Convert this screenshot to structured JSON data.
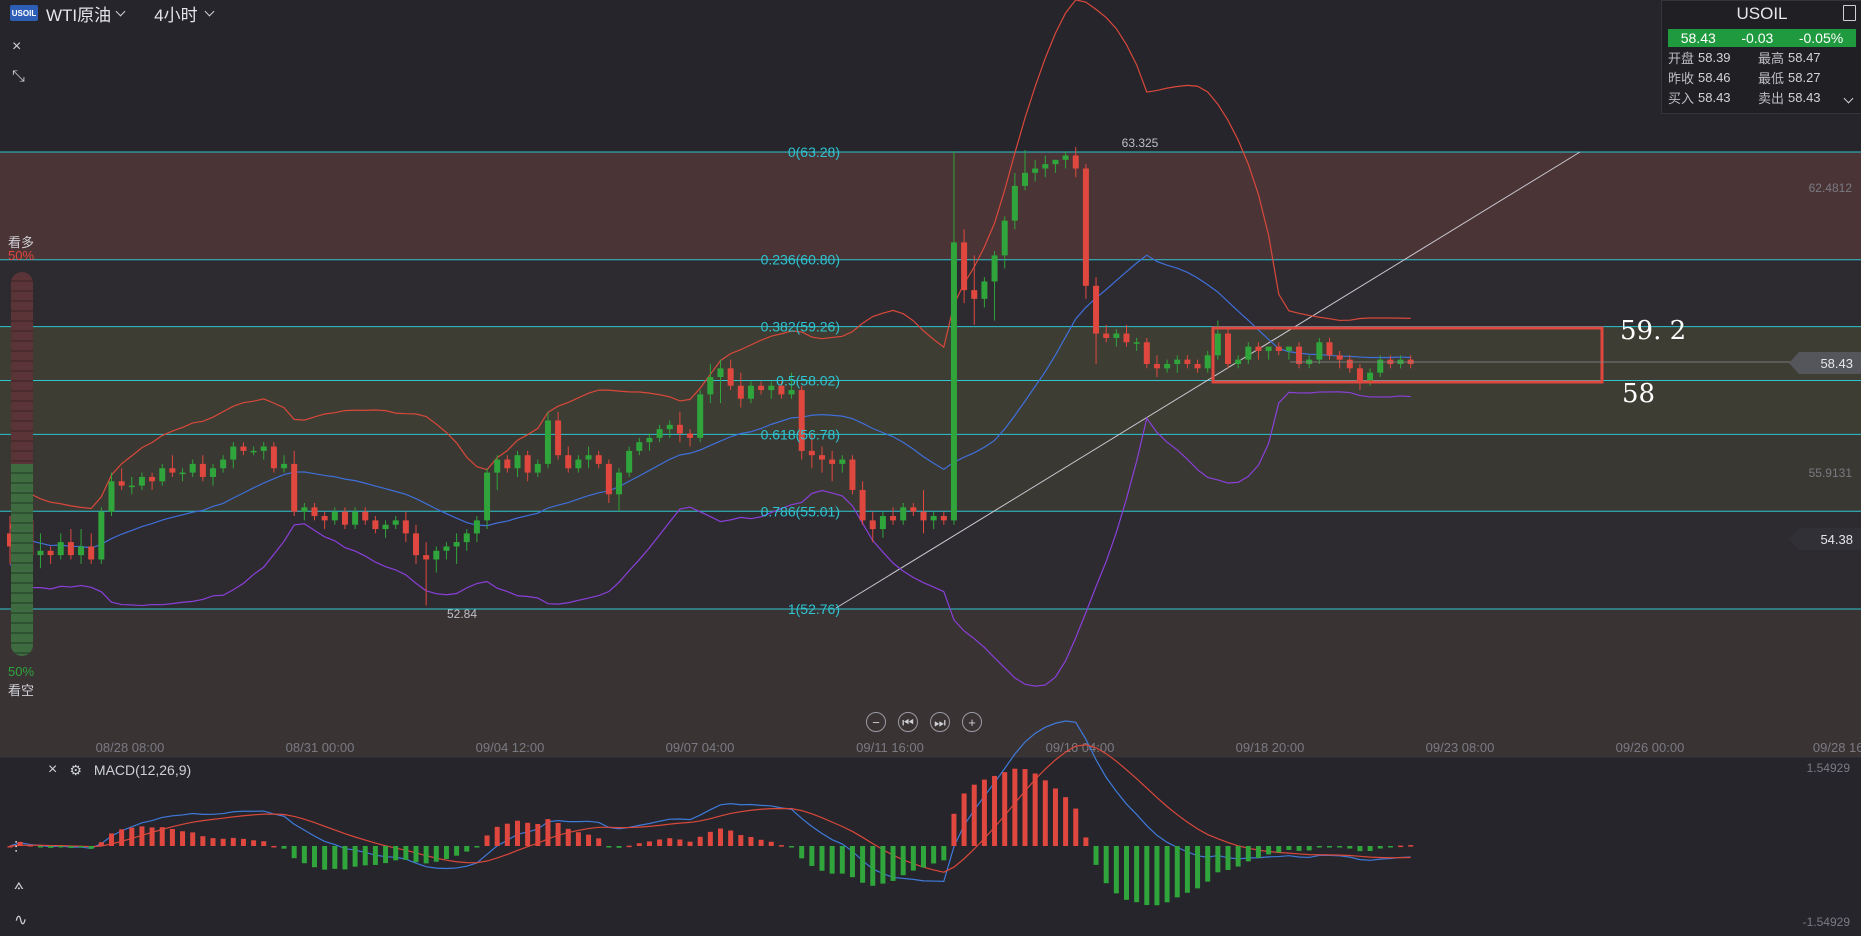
{
  "header": {
    "logo_text": "USOIL",
    "symbol": "WTI原油",
    "timeframe": "4小时"
  },
  "toolbar_left": {
    "close": "×",
    "shrink": "⤡"
  },
  "quote_panel": {
    "title": "USOIL",
    "last": "58.43",
    "change": "-0.03",
    "change_pct": "-0.05%",
    "rows": [
      [
        {
          "label": "开盘",
          "value": "58.39"
        },
        {
          "label": "最高",
          "value": "58.47"
        }
      ],
      [
        {
          "label": "昨收",
          "value": "58.46"
        },
        {
          "label": "最低",
          "value": "58.27"
        }
      ],
      [
        {
          "label": "买入",
          "value": "58.43"
        },
        {
          "label": "卖出",
          "value": "58.43"
        }
      ]
    ]
  },
  "sentiment": {
    "bull_label": "看多",
    "bull_pct": "50%",
    "bear_label": "看空",
    "bear_pct": "50%"
  },
  "price_axis": {
    "right_labels": [
      "62.4812",
      "55.9131"
    ],
    "current_price": "58.43",
    "marker_price": "54.38"
  },
  "annotations": {
    "high_label": "63.325",
    "low_label": "52.84",
    "box_top": "59. 2",
    "box_bottom": "58"
  },
  "fib_levels": [
    {
      "label": "0(63.28)",
      "price": 63.28
    },
    {
      "label": "0.236(60.80)",
      "price": 60.8
    },
    {
      "label": "0.382(59.26)",
      "price": 59.26
    },
    {
      "label": "0.5(58.02)",
      "price": 58.02
    },
    {
      "label": "0.618(56.78)",
      "price": 56.78
    },
    {
      "label": "0.786(55.01)",
      "price": 55.01
    },
    {
      "label": "1(52.76)",
      "price": 52.76
    }
  ],
  "time_axis": [
    "08/28 08:00",
    "08/31 00:00",
    "09/04 12:00",
    "09/07 04:00",
    "09/11 16:00",
    "09/16 04:00",
    "09/18 20:00",
    "09/23 08:00",
    "09/26 00:00",
    "09/28 16:"
  ],
  "macd": {
    "title": "MACD(12,26,9)",
    "axis_top": "1.54929",
    "axis_bottom": "-1.54929"
  },
  "colors": {
    "up": "#2fa53b",
    "down": "#e0483f",
    "fib": "#2ec4d0",
    "bb_upper": "#d9483b",
    "bb_mid": "#3f6fd9",
    "bb_lower": "#8a3fd9",
    "macd_line": "#3f7ad9",
    "signal_line": "#d9483b"
  },
  "nav_buttons": [
    "−",
    "⏮",
    "⏭",
    "+"
  ],
  "chart_data": {
    "type": "candlestick",
    "ylim": [
      51.5,
      65.5
    ],
    "candles": [
      [
        54.5,
        54.9,
        53.8,
        54.2
      ],
      [
        54.2,
        55.0,
        53.9,
        54.8
      ],
      [
        54.8,
        55.2,
        53.9,
        54.0
      ],
      [
        54.0,
        54.5,
        53.7,
        54.1
      ],
      [
        54.1,
        54.2,
        53.8,
        54.0
      ],
      [
        54.0,
        54.5,
        53.9,
        54.3
      ],
      [
        54.3,
        54.6,
        53.9,
        54.0
      ],
      [
        54.0,
        54.6,
        53.8,
        54.2
      ],
      [
        54.2,
        54.5,
        53.8,
        53.9
      ],
      [
        53.9,
        55.1,
        53.8,
        55.0
      ],
      [
        55.0,
        55.9,
        54.9,
        55.7
      ],
      [
        55.7,
        56.0,
        55.5,
        55.6
      ],
      [
        55.6,
        55.8,
        55.4,
        55.6
      ],
      [
        55.6,
        55.9,
        55.5,
        55.8
      ],
      [
        55.8,
        55.9,
        55.5,
        55.7
      ],
      [
        55.7,
        56.1,
        55.6,
        56.0
      ],
      [
        56.0,
        56.3,
        55.8,
        55.9
      ],
      [
        55.9,
        56.0,
        55.7,
        55.9
      ],
      [
        55.9,
        56.2,
        55.8,
        56.1
      ],
      [
        56.1,
        56.3,
        55.7,
        55.8
      ],
      [
        55.8,
        56.1,
        55.6,
        56.0
      ],
      [
        56.0,
        56.3,
        55.9,
        56.2
      ],
      [
        56.2,
        56.6,
        56.0,
        56.5
      ],
      [
        56.5,
        56.6,
        56.3,
        56.4
      ],
      [
        56.4,
        56.5,
        56.3,
        56.4
      ],
      [
        56.4,
        56.6,
        56.2,
        56.5
      ],
      [
        56.5,
        56.6,
        55.9,
        56.0
      ],
      [
        56.0,
        56.3,
        55.9,
        56.1
      ],
      [
        56.1,
        56.4,
        54.9,
        55.0
      ],
      [
        55.0,
        55.2,
        54.8,
        55.1
      ],
      [
        55.1,
        55.2,
        54.8,
        54.9
      ],
      [
        54.9,
        55.0,
        54.6,
        54.8
      ],
      [
        54.8,
        55.1,
        54.7,
        55.0
      ],
      [
        55.0,
        55.1,
        54.6,
        54.7
      ],
      [
        54.7,
        55.1,
        54.6,
        55.0
      ],
      [
        55.0,
        55.1,
        54.7,
        54.8
      ],
      [
        54.8,
        54.9,
        54.5,
        54.6
      ],
      [
        54.6,
        54.8,
        54.4,
        54.7
      ],
      [
        54.7,
        54.9,
        54.6,
        54.8
      ],
      [
        54.8,
        55.0,
        54.3,
        54.5
      ],
      [
        54.5,
        54.7,
        53.8,
        54.0
      ],
      [
        54.0,
        54.3,
        52.84,
        53.9
      ],
      [
        53.9,
        54.2,
        53.6,
        54.1
      ],
      [
        54.1,
        54.3,
        53.9,
        54.2
      ],
      [
        54.2,
        54.5,
        53.8,
        54.3
      ],
      [
        54.3,
        54.6,
        54.1,
        54.5
      ],
      [
        54.5,
        54.9,
        54.3,
        54.8
      ],
      [
        54.8,
        56.0,
        54.6,
        55.9
      ],
      [
        55.9,
        56.3,
        55.5,
        56.2
      ],
      [
        56.2,
        56.3,
        55.9,
        56.0
      ],
      [
        56.0,
        56.4,
        55.8,
        56.3
      ],
      [
        56.3,
        56.4,
        55.7,
        55.9
      ],
      [
        55.9,
        56.2,
        55.8,
        56.1
      ],
      [
        56.1,
        57.3,
        56.0,
        57.1
      ],
      [
        57.1,
        57.3,
        56.2,
        56.3
      ],
      [
        56.3,
        56.5,
        55.9,
        56.0
      ],
      [
        56.0,
        56.3,
        55.9,
        56.2
      ],
      [
        56.2,
        56.5,
        56.0,
        56.3
      ],
      [
        56.3,
        56.4,
        56.0,
        56.1
      ],
      [
        56.1,
        56.2,
        55.2,
        55.4
      ],
      [
        55.4,
        56.0,
        55.0,
        55.9
      ],
      [
        55.9,
        56.5,
        55.8,
        56.4
      ],
      [
        56.4,
        56.7,
        56.3,
        56.6
      ],
      [
        56.6,
        56.8,
        56.4,
        56.7
      ],
      [
        56.7,
        57.0,
        56.6,
        56.9
      ],
      [
        56.9,
        57.1,
        56.7,
        57.0
      ],
      [
        57.0,
        57.3,
        56.6,
        56.8
      ],
      [
        56.8,
        56.9,
        56.5,
        56.7
      ],
      [
        56.7,
        57.8,
        56.6,
        57.7
      ],
      [
        57.7,
        58.4,
        57.5,
        58.1
      ],
      [
        58.1,
        58.5,
        57.5,
        58.3
      ],
      [
        58.3,
        58.5,
        57.8,
        57.9
      ],
      [
        57.9,
        58.2,
        57.4,
        57.6
      ],
      [
        57.6,
        58.0,
        57.5,
        57.9
      ],
      [
        57.9,
        58.0,
        57.7,
        57.8
      ],
      [
        57.8,
        58.0,
        57.6,
        57.9
      ],
      [
        57.9,
        58.0,
        57.6,
        57.7
      ],
      [
        57.7,
        58.2,
        57.6,
        57.8
      ],
      [
        57.8,
        57.9,
        56.2,
        56.4
      ],
      [
        56.4,
        56.8,
        56.0,
        56.3
      ],
      [
        56.3,
        56.5,
        55.9,
        56.2
      ],
      [
        56.2,
        56.4,
        55.7,
        56.1
      ],
      [
        56.1,
        56.3,
        55.9,
        56.2
      ],
      [
        56.2,
        56.3,
        55.4,
        55.5
      ],
      [
        55.5,
        55.7,
        54.7,
        54.8
      ],
      [
        54.8,
        55.0,
        54.3,
        54.6
      ],
      [
        54.6,
        55.0,
        54.4,
        54.9
      ],
      [
        54.9,
        55.1,
        54.7,
        54.8
      ],
      [
        54.8,
        55.2,
        54.7,
        55.1
      ],
      [
        55.1,
        55.2,
        54.9,
        55.0
      ],
      [
        55.0,
        55.5,
        54.5,
        54.8
      ],
      [
        54.8,
        55.0,
        54.6,
        54.9
      ],
      [
        54.9,
        55.0,
        54.7,
        54.8
      ],
      [
        54.8,
        63.3,
        54.7,
        61.2
      ],
      [
        61.2,
        61.5,
        59.8,
        60.1
      ],
      [
        60.1,
        60.9,
        59.3,
        59.9
      ],
      [
        59.9,
        60.4,
        59.7,
        60.3
      ],
      [
        60.3,
        61.0,
        59.4,
        60.9
      ],
      [
        60.9,
        61.8,
        60.6,
        61.7
      ],
      [
        61.7,
        62.8,
        61.5,
        62.5
      ],
      [
        62.5,
        63.325,
        62.4,
        62.8
      ],
      [
        62.8,
        63.1,
        62.6,
        62.9
      ],
      [
        62.9,
        63.2,
        62.7,
        63.0
      ],
      [
        63.0,
        63.1,
        62.8,
        63.1
      ],
      [
        63.1,
        63.3,
        62.9,
        63.2
      ],
      [
        63.2,
        63.4,
        62.7,
        62.9
      ],
      [
        62.9,
        63.0,
        59.9,
        60.2
      ],
      [
        60.2,
        60.4,
        58.4,
        59.1
      ],
      [
        59.1,
        59.3,
        58.9,
        59.0
      ],
      [
        59.0,
        59.2,
        58.8,
        59.1
      ],
      [
        59.1,
        59.3,
        58.8,
        58.9
      ],
      [
        58.9,
        59.0,
        58.7,
        58.9
      ],
      [
        58.9,
        59.0,
        58.3,
        58.4
      ],
      [
        58.4,
        58.6,
        58.1,
        58.3
      ],
      [
        58.3,
        58.5,
        58.2,
        58.4
      ],
      [
        58.4,
        58.6,
        58.2,
        58.5
      ],
      [
        58.5,
        58.6,
        58.3,
        58.4
      ],
      [
        58.4,
        58.5,
        58.2,
        58.3
      ],
      [
        58.3,
        58.7,
        58.2,
        58.6
      ],
      [
        58.6,
        59.4,
        58.5,
        59.1
      ],
      [
        59.1,
        59.2,
        58.3,
        58.4
      ],
      [
        58.4,
        58.6,
        58.3,
        58.5
      ],
      [
        58.5,
        58.9,
        58.4,
        58.8
      ],
      [
        58.8,
        58.9,
        58.5,
        58.7
      ],
      [
        58.7,
        58.8,
        58.5,
        58.8
      ],
      [
        58.8,
        58.9,
        58.6,
        58.7
      ],
      [
        58.7,
        58.8,
        58.5,
        58.8
      ],
      [
        58.8,
        58.9,
        58.3,
        58.4
      ],
      [
        58.4,
        58.6,
        58.3,
        58.5
      ],
      [
        58.5,
        59.0,
        58.4,
        58.9
      ],
      [
        58.9,
        59.0,
        58.5,
        58.6
      ],
      [
        58.6,
        58.7,
        58.3,
        58.5
      ],
      [
        58.5,
        58.6,
        58.2,
        58.3
      ],
      [
        58.3,
        58.4,
        57.8,
        58.0
      ],
      [
        58.0,
        58.3,
        57.9,
        58.2
      ],
      [
        58.2,
        58.6,
        58.1,
        58.5
      ],
      [
        58.5,
        58.6,
        58.3,
        58.4
      ],
      [
        58.4,
        58.6,
        58.3,
        58.5
      ],
      [
        58.5,
        58.6,
        58.3,
        58.4
      ]
    ]
  }
}
